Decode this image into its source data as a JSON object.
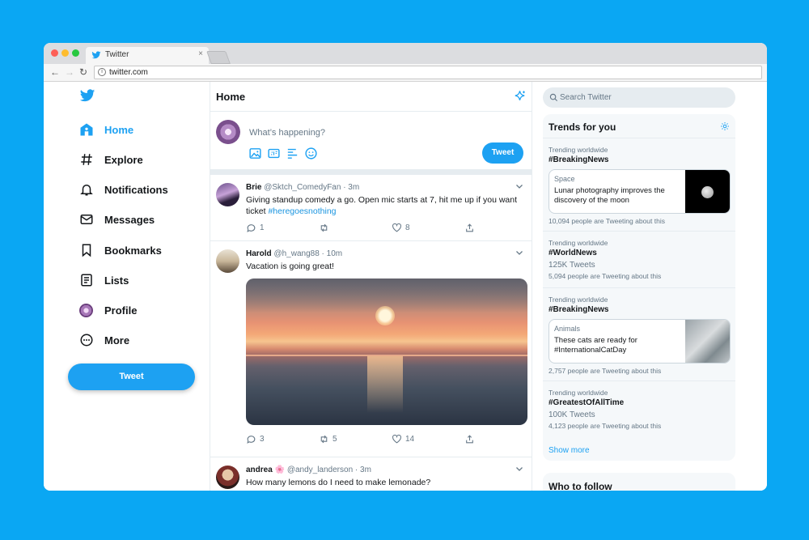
{
  "browser": {
    "tab_title": "Twitter",
    "tab_close": "×",
    "url": "twitter.com",
    "info_glyph": "i",
    "nav_back": "←",
    "nav_forward": "→",
    "nav_reload": "↻"
  },
  "sidebar": {
    "items": [
      {
        "label": "Home",
        "icon": "home-icon",
        "active": true
      },
      {
        "label": "Explore",
        "icon": "hashtag-icon"
      },
      {
        "label": "Notifications",
        "icon": "bell-icon"
      },
      {
        "label": "Messages",
        "icon": "envelope-icon"
      },
      {
        "label": "Bookmarks",
        "icon": "bookmark-icon"
      },
      {
        "label": "Lists",
        "icon": "list-icon"
      },
      {
        "label": "Profile",
        "icon": "avatar-icon"
      },
      {
        "label": "More",
        "icon": "more-icon"
      }
    ],
    "tweet_button": "Tweet"
  },
  "feed": {
    "title": "Home",
    "compose": {
      "placeholder": "What’s happening?",
      "button": "Tweet"
    },
    "tweets": [
      {
        "name": "Brie",
        "handle": "@Sktch_ComedyFan · 3m",
        "text": "Giving standup comedy a go. Open mic starts at 7, hit me up if you want ticket ",
        "hashtag": "#heregoesnothing",
        "replies": "1",
        "retweets": "",
        "likes": "8"
      },
      {
        "name": "Harold",
        "handle": "@h_wang88 · 10m",
        "text": "Vacation is going great!",
        "replies": "3",
        "retweets": "5",
        "likes": "14"
      },
      {
        "name": "andrea",
        "flower": "🌸",
        "handle": "@andy_landerson · 3m",
        "text": "How many lemons do I need to make lemonade?"
      }
    ]
  },
  "search": {
    "placeholder": "Search Twitter"
  },
  "trends": {
    "title": "Trends for you",
    "items": [
      {
        "label": "Trending worldwide",
        "tag": "#BreakingNews",
        "card_category": "Space",
        "card_headline": "Lunar photography improves the discovery of the moon",
        "count": "10,094 people are Tweeting about this"
      },
      {
        "label": "Trending worldwide",
        "tag": "#WorldNews",
        "tweets": "125K Tweets",
        "count": "5,094 people are Tweeting about this"
      },
      {
        "label": "Trending worldwide",
        "tag": "#BreakingNews",
        "card_category": "Animals",
        "card_headline": "These cats are ready for #InternationalCatDay",
        "count": "2,757 people are Tweeting about this"
      },
      {
        "label": "Trending worldwide",
        "tag": "#GreatestOfAllTime",
        "tweets": "100K Tweets",
        "count": "4,123 people are Tweeting about this"
      }
    ],
    "show_more": "Show more"
  },
  "who_to_follow": {
    "title": "Who to follow"
  },
  "colors": {
    "accent": "#1da1f2",
    "background": "#0aa7f3"
  }
}
